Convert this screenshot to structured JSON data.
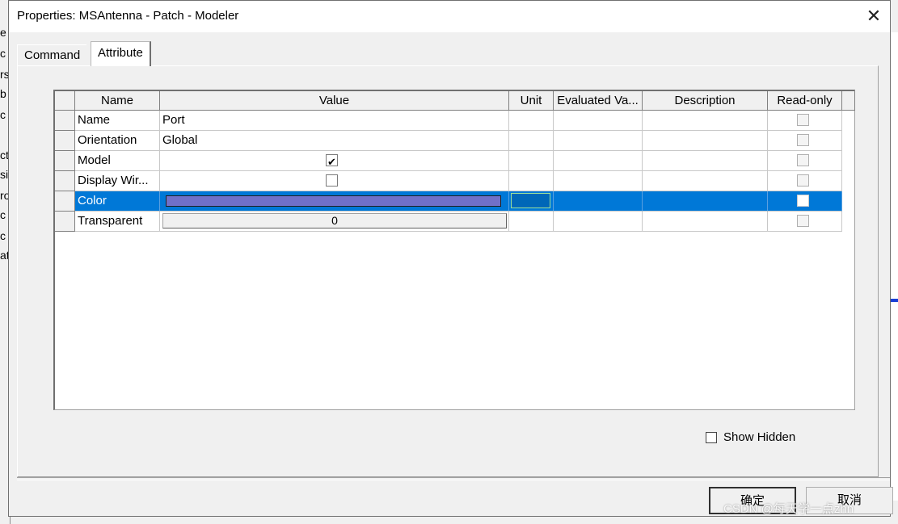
{
  "background_fragments": [
    "e",
    "c",
    "rs",
    "b",
    "c",
    "ct",
    "si",
    "ro",
    "c",
    "c",
    "at"
  ],
  "dialog": {
    "title": "Properties: MSAntenna - Patch - Modeler",
    "close_glyph": "✕"
  },
  "tabs": [
    {
      "label": "Command",
      "active": false
    },
    {
      "label": "Attribute",
      "active": true
    }
  ],
  "grid": {
    "columns": [
      "Name",
      "Value",
      "Unit",
      "Evaluated Va...",
      "Description",
      "Read-only"
    ],
    "rows": [
      {
        "name": "Name",
        "value": "Port",
        "unit": "",
        "evaluated": "",
        "description": "",
        "read_only": false
      },
      {
        "name": "Orientation",
        "value": "Global",
        "unit": "",
        "evaluated": "",
        "description": "",
        "read_only": false
      },
      {
        "name": "Model",
        "value_checkbox": true,
        "unit": "",
        "evaluated": "",
        "description": "",
        "read_only": false
      },
      {
        "name": "Display Wir...",
        "value_checkbox": false,
        "unit": "",
        "evaluated": "",
        "description": "",
        "read_only": false
      },
      {
        "name": "Color",
        "color_value": "#7070c8",
        "selected": true,
        "unit": "",
        "evaluated": "",
        "description": "",
        "read_only": false
      },
      {
        "name": "Transparent",
        "value": "0",
        "unit": "",
        "evaluated": "",
        "description": "",
        "read_only": false
      }
    ]
  },
  "show_hidden": {
    "label": "Show Hidden",
    "checked": false
  },
  "buttons": {
    "ok": "确定",
    "cancel": "取消"
  },
  "watermark": "CSDN @每天学一点zhn",
  "colors": {
    "selection": "#0078d7",
    "swatch": "#7070c8"
  }
}
